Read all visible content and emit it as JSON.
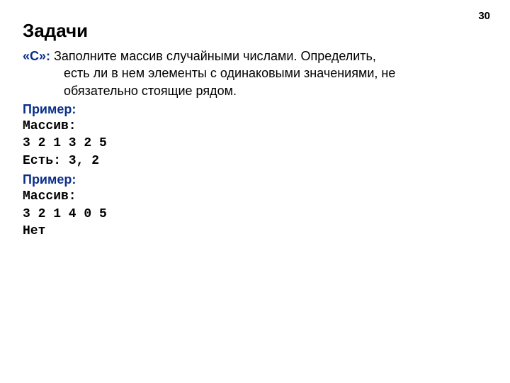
{
  "page_number": "30",
  "title": "Задачи",
  "task": {
    "label": "«С»:",
    "desc_line1": " Заполните массив случайными числами. Определить,",
    "desc_line2": "есть ли в нем элементы с одинаковыми значениями, не",
    "desc_line3": "обязательно стоящие рядом."
  },
  "example1": {
    "label": "Пример:",
    "line1": "Массив:",
    "line2": "3 2 1 3 2 5",
    "line3": "Есть: 3, 2"
  },
  "example2": {
    "label": "Пример:",
    "line1": "Массив:",
    "line2": "3 2 1 4 0 5",
    "line3": "Нет"
  }
}
